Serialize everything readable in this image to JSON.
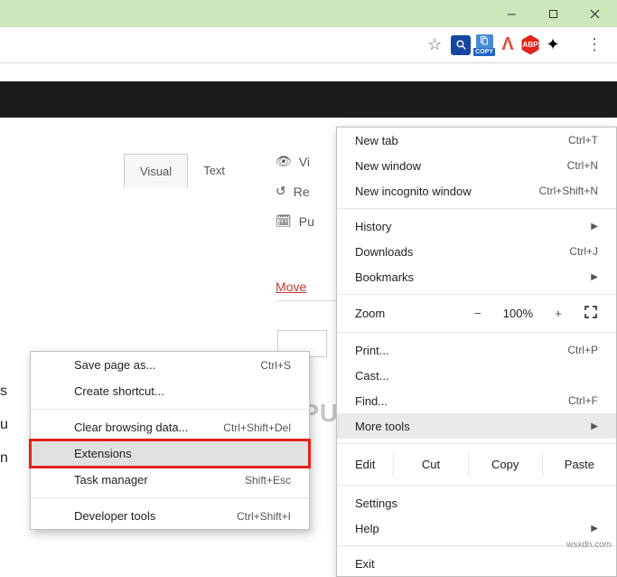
{
  "titlebar": {},
  "toolbar": {
    "copy_badge": "COPY",
    "abp": "ABP"
  },
  "page": {
    "tabs": {
      "visual": "Visual",
      "text": "Text"
    },
    "side": {
      "vi": "Vi",
      "re": "Re",
      "pu": "Pu"
    },
    "move": "Move",
    "left_lines": [
      "s",
      "u",
      "n"
    ]
  },
  "menu": {
    "newtab": "New tab",
    "newtab_sc": "Ctrl+T",
    "newwin": "New window",
    "newwin_sc": "Ctrl+N",
    "incog": "New incognito window",
    "incog_sc": "Ctrl+Shift+N",
    "history": "History",
    "downloads": "Downloads",
    "downloads_sc": "Ctrl+J",
    "bookmarks": "Bookmarks",
    "zoom": "Zoom",
    "zoom_minus": "−",
    "zoom_val": "100%",
    "zoom_plus": "+",
    "print": "Print...",
    "print_sc": "Ctrl+P",
    "cast": "Cast...",
    "find": "Find...",
    "find_sc": "Ctrl+F",
    "more": "More tools",
    "edit": "Edit",
    "cut": "Cut",
    "copy": "Copy",
    "paste": "Paste",
    "settings": "Settings",
    "help": "Help",
    "exit": "Exit"
  },
  "submenu": {
    "save": "Save page as...",
    "save_sc": "Ctrl+S",
    "shortcut": "Create shortcut...",
    "clear": "Clear browsing data...",
    "clear_sc": "Ctrl+Shift+Del",
    "ext": "Extensions",
    "task": "Task manager",
    "task_sc": "Shift+Esc",
    "dev": "Developer tools",
    "dev_sc": "Ctrl+Shift+I"
  },
  "logo_text": "A   PUALS",
  "watermark": "wsxdn.com"
}
